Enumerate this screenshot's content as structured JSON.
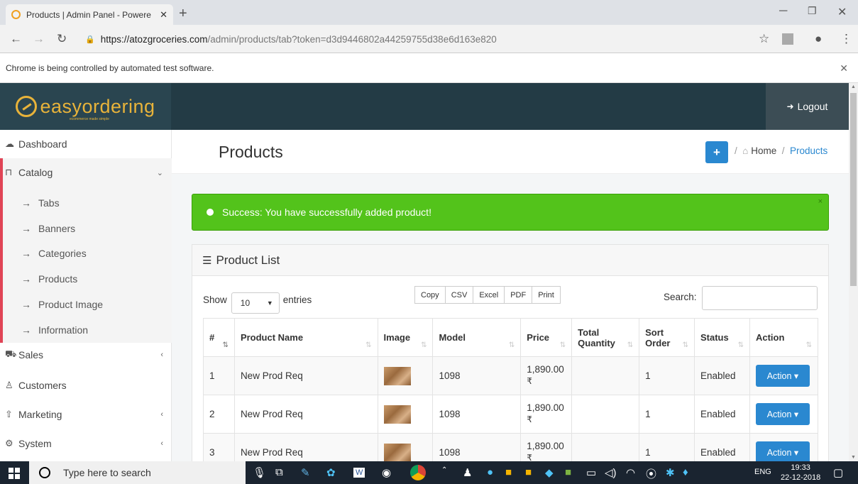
{
  "browser": {
    "tab_title": "Products | Admin Panel - Powere",
    "url_host": "https://atozgroceries.com",
    "url_path": "/admin/products/tab?token=d3d9446802a44259755d38e6d163e820",
    "infobar_text": "Chrome is being controlled by automated test software."
  },
  "header": {
    "logo_text": "easyordering",
    "logo_tagline": "ecommerce made simple",
    "logout_label": "Logout"
  },
  "sidebar": {
    "items": [
      {
        "label": "Dashboard",
        "icon": "dashboard-icon"
      },
      {
        "label": "Catalog",
        "icon": "catalog-icon"
      },
      {
        "label": "Sales",
        "icon": "cart-icon"
      },
      {
        "label": "Customers",
        "icon": "user-icon"
      },
      {
        "label": "Marketing",
        "icon": "share-icon"
      },
      {
        "label": "System",
        "icon": "gear-icon"
      }
    ],
    "catalog_sub": [
      "Tabs",
      "Banners",
      "Categories",
      "Products",
      "Product Image",
      "Information"
    ]
  },
  "page": {
    "title": "Products",
    "breadcrumb_home": "Home",
    "breadcrumb_sep": "/",
    "breadcrumb_current": "Products"
  },
  "alert": {
    "text": "Success: You have successfully added product!",
    "close": "×"
  },
  "panel": {
    "title": "Product List",
    "show_label": "Show",
    "entries_value": "10",
    "entries_label": "entries",
    "buttons": [
      "Copy",
      "CSV",
      "Excel",
      "PDF",
      "Print"
    ],
    "search_label": "Search:"
  },
  "table": {
    "headers": [
      "#",
      "Product Name",
      "Image",
      "Model",
      "Price",
      "Total Quantity",
      "Sort Order",
      "Status",
      "Action"
    ],
    "rows": [
      {
        "num": "1",
        "name": "New Prod Req",
        "model": "1098",
        "price": "1,890.00",
        "currency": "₹",
        "qty": "",
        "sort": "1",
        "status": "Enabled",
        "action": "Action"
      },
      {
        "num": "2",
        "name": "New Prod Req",
        "model": "1098",
        "price": "1,890.00",
        "currency": "₹",
        "qty": "",
        "sort": "1",
        "status": "Enabled",
        "action": "Action"
      },
      {
        "num": "3",
        "name": "New Prod Req",
        "model": "1098",
        "price": "1,890.00",
        "currency": "₹",
        "qty": "",
        "sort": "1",
        "status": "Enabled",
        "action": "Action"
      }
    ]
  },
  "taskbar": {
    "search_placeholder": "Type here to search",
    "lang": "ENG",
    "time": "19:33",
    "date": "22-12-2018"
  },
  "colors": {
    "header_bg": "#233b45",
    "accent_blue": "#2a88d0",
    "success_green": "#53c31b",
    "logo_gold": "#e8b33a",
    "active_marker": "#e04456"
  }
}
